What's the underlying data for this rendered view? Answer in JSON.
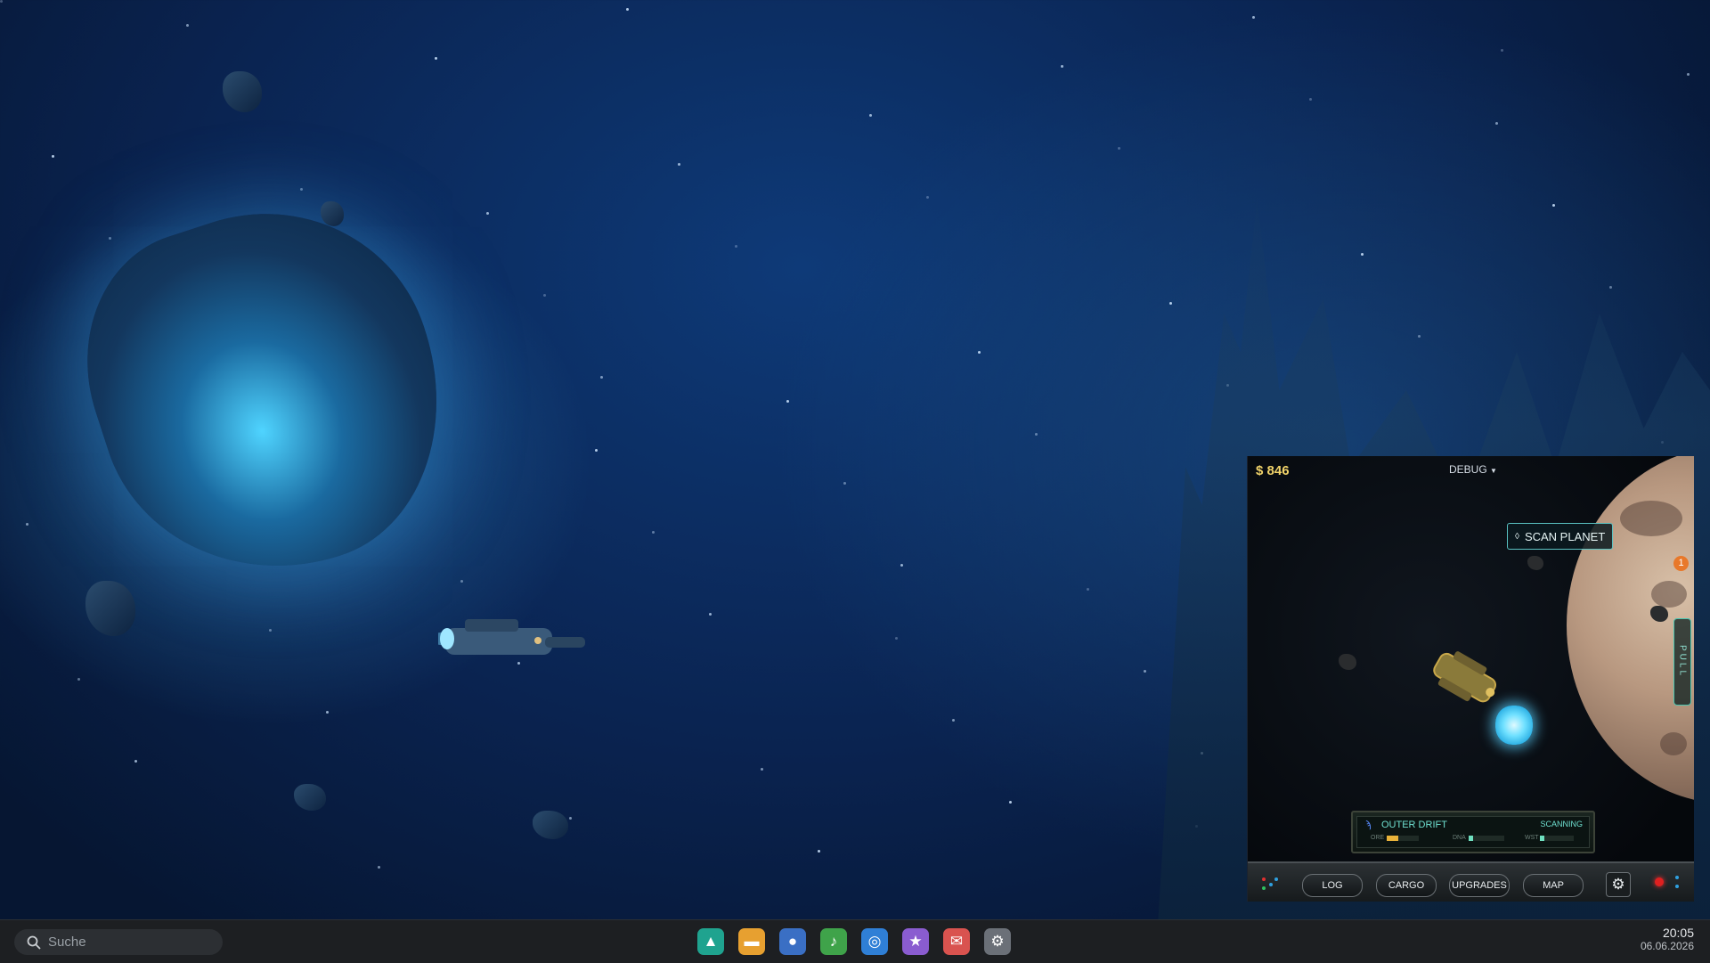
{
  "game": {
    "money": "$ 846",
    "debug_label": "DEBUG",
    "scan_button": "SCAN PLANET",
    "notification_count": "1",
    "pull_label": "PULL",
    "status": {
      "zone": "OUTER DRIFT",
      "state": "SCANNING",
      "meters": [
        {
          "label": "ORE",
          "level": 0.35,
          "color": "#e8b23a"
        },
        {
          "label": "DNA",
          "level": 0.12,
          "color": "#6fe0c0"
        },
        {
          "label": "WST",
          "level": 0.12,
          "color": "#6fe0c0"
        }
      ]
    },
    "buttons": [
      "LOG",
      "CARGO",
      "UPGRADES",
      "MAP"
    ]
  },
  "taskbar": {
    "search_placeholder": "Suche",
    "apps": [
      {
        "name": "launcher",
        "icon": "triangle-icon",
        "color": "#1fa38f",
        "glyph": "▲"
      },
      {
        "name": "files",
        "icon": "folder-icon",
        "color": "#e7a030",
        "glyph": "▬"
      },
      {
        "name": "chat",
        "icon": "chat-icon",
        "color": "#3a6fc4",
        "glyph": "●"
      },
      {
        "name": "music",
        "icon": "music-icon",
        "color": "#3fa34a",
        "glyph": "♪"
      },
      {
        "name": "browser",
        "icon": "globe-icon",
        "color": "#2f7fd6",
        "glyph": "◎"
      },
      {
        "name": "favorites",
        "icon": "star-icon",
        "color": "#8a5cd0",
        "glyph": "★"
      },
      {
        "name": "mail",
        "icon": "mail-icon",
        "color": "#d9534f",
        "glyph": "✉"
      },
      {
        "name": "settings",
        "icon": "gear-icon",
        "color": "#6b7078",
        "glyph": "⚙"
      }
    ],
    "time": "20:05",
    "date": "06.06.2026"
  }
}
